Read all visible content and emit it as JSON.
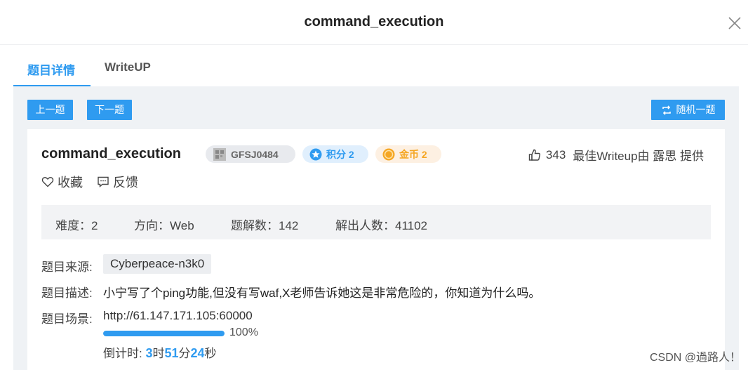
{
  "modal": {
    "title": "command_execution"
  },
  "tabs": [
    {
      "label": "题目详情",
      "active": true
    },
    {
      "label": "WriteUP",
      "active": false
    }
  ],
  "nav": {
    "prev_label": "上一题",
    "next_label": "下一题",
    "random_label": "随机一题"
  },
  "challenge": {
    "title": "command_execution",
    "id_badge": "GFSJ0484",
    "score_badge": "积分 2",
    "coin_badge": "金币 2",
    "likes": "343",
    "writeup_credit": "最佳Writeup由 露思 提供",
    "favorite_label": "收藏",
    "feedback_label": "反馈"
  },
  "stats": {
    "difficulty": "难度：2",
    "direction": "方向：Web",
    "solves": "题解数：142",
    "solvers": "解出人数：41102"
  },
  "details": {
    "source_label": "题目来源:",
    "source_value": "Cyberpeace-n3k0",
    "desc_label": "题目描述:",
    "desc_value": "小宁写了个ping功能,但没有写waf,X老师告诉她这是非常危险的，你知道为什么吗。",
    "scene_label": "题目场景:",
    "scene_url": "http://61.147.171.105:60000",
    "progress_percent": 100,
    "progress_text": "100%",
    "countdown_prefix": "倒计时: ",
    "countdown_hours": "3",
    "countdown_hours_unit": "时",
    "countdown_minutes": "51",
    "countdown_minutes_unit": "分",
    "countdown_seconds": "24",
    "countdown_seconds_unit": "秒"
  },
  "watermark": "CSDN @過路人！",
  "colors": {
    "accent": "#2f9bf0",
    "coin": "#f5a623",
    "panel_bg": "#eff2f5"
  }
}
